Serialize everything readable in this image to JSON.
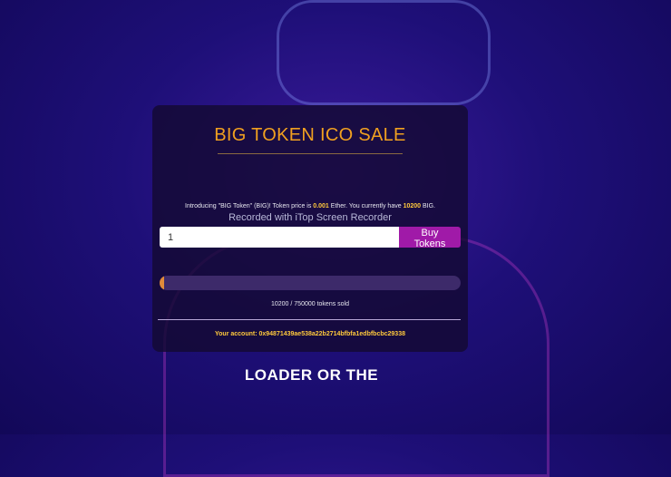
{
  "card": {
    "title": "BIG TOKEN ICO SALE",
    "intro": {
      "prefix": "Introducing \"BIG Token\" (BIG)! Token price is ",
      "price": "0.001",
      "middle": " Ether. You currently have ",
      "balance": "10200",
      "suffix": " BIG."
    },
    "watermark": "Recorded with iTop Screen Recorder",
    "quantity_value": "1",
    "buy_label": "Buy Tokens",
    "progress": {
      "sold": 10200,
      "total": 750000,
      "percent": 1.36,
      "text": "10200 / 750000 tokens sold"
    },
    "account": "Your account: 0x94871439ae538a22b2714bfbfa1edbfbcbc29338"
  },
  "footer_text": "LOADER OR THE",
  "colors": {
    "accent": "#f0a020",
    "button": "#a01aa8",
    "progress_fill": "#e08a3a"
  }
}
